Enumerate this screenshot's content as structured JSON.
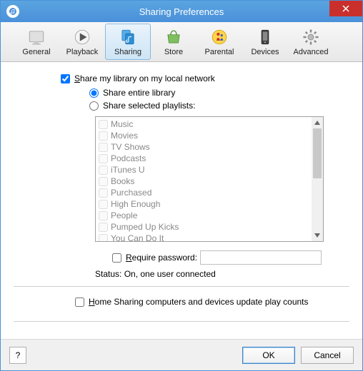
{
  "window": {
    "title": "Sharing Preferences"
  },
  "toolbar": {
    "items": [
      {
        "label": "General"
      },
      {
        "label": "Playback"
      },
      {
        "label": "Sharing"
      },
      {
        "label": "Store"
      },
      {
        "label": "Parental"
      },
      {
        "label": "Devices"
      },
      {
        "label": "Advanced"
      }
    ],
    "active_index": 2
  },
  "checkboxes": {
    "share_library": "Share my library on my local network",
    "entire": "Share entire library",
    "selected": "Share selected playlists:",
    "require_pwd": "Require password:",
    "home_sharing": "Home Sharing computers and devices update play counts"
  },
  "playlists": [
    "Music",
    "Movies",
    "TV Shows",
    "Podcasts",
    "iTunes U",
    "Books",
    "Purchased",
    "High Enough",
    "People",
    "Pumped Up Kicks",
    "You Can Do It"
  ],
  "status": {
    "label": "Status:",
    "value": "On, one user connected"
  },
  "buttons": {
    "ok": "OK",
    "cancel": "Cancel",
    "help": "?"
  }
}
